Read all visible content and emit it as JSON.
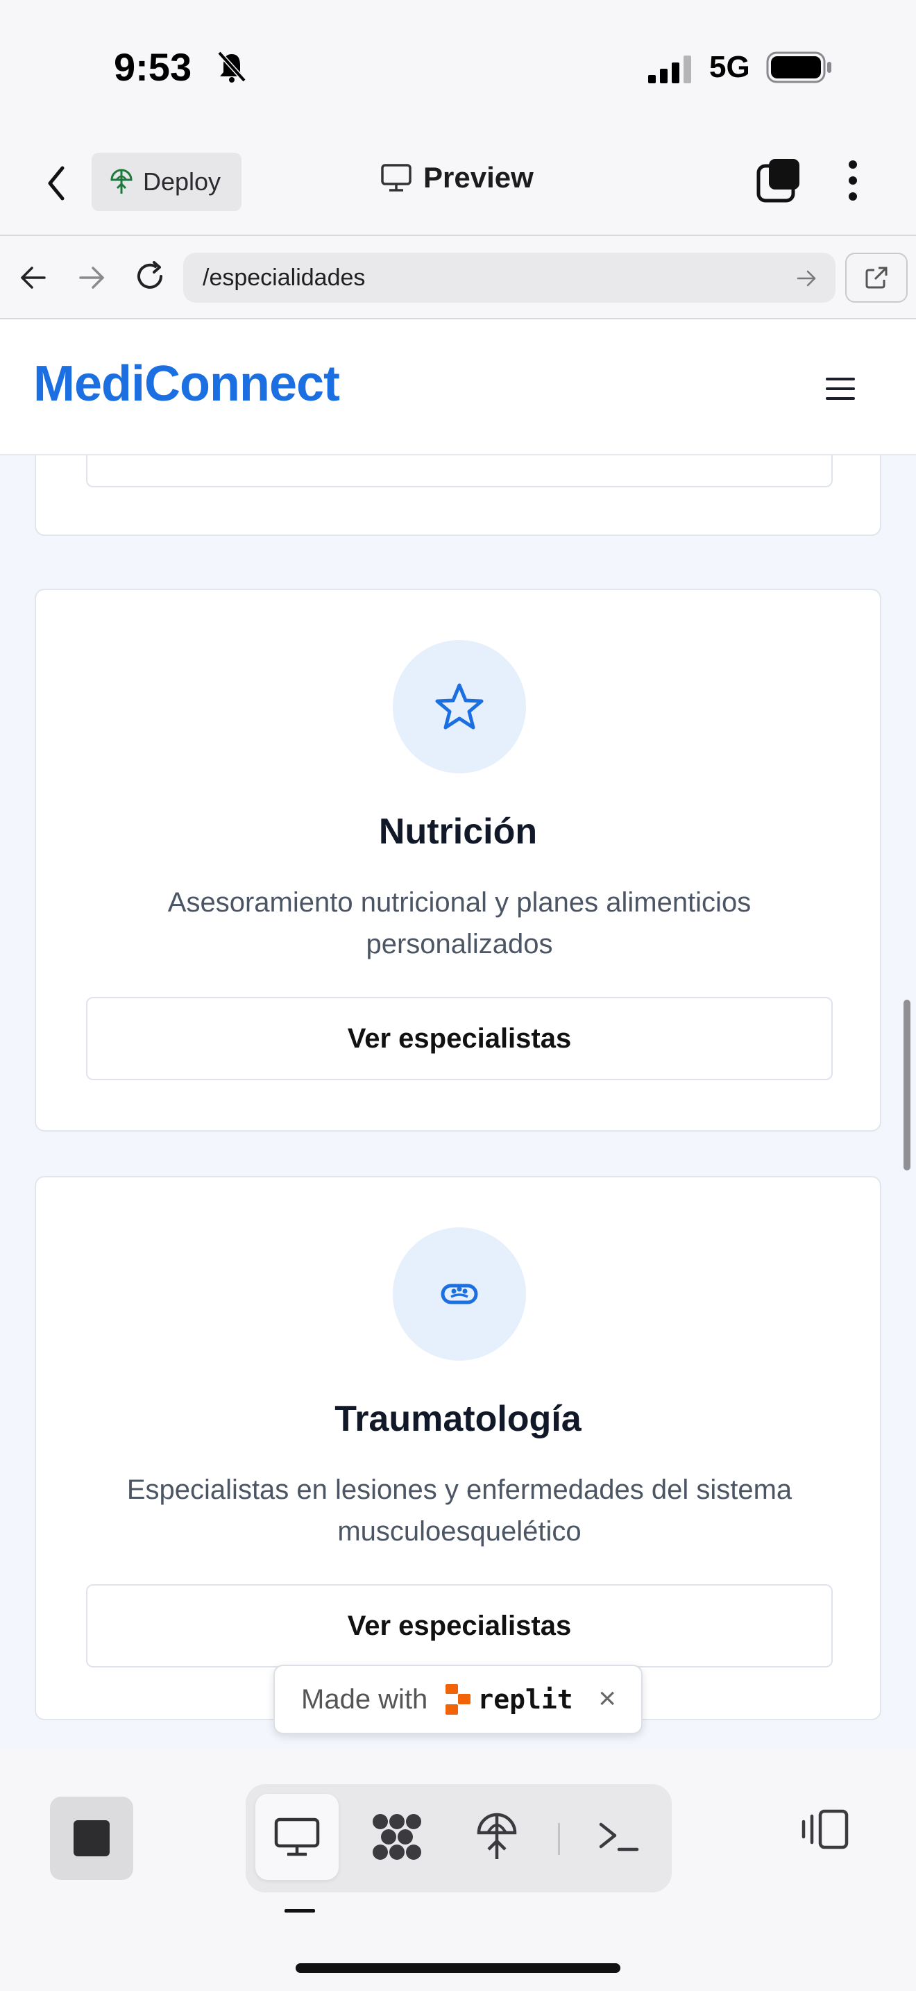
{
  "status_bar": {
    "time": "9:53",
    "network": "5G"
  },
  "toolbar": {
    "deploy_label": "Deploy",
    "preview_label": "Preview"
  },
  "url_bar": {
    "path": "/especialidades"
  },
  "site": {
    "brand": "MediConnect"
  },
  "cards": [
    {
      "icon": "star-icon",
      "title": "Nutrición",
      "description": "Asesoramiento nutricional y planes alimenticios personalizados",
      "button": "Ver especialistas"
    },
    {
      "icon": "bone-icon",
      "title": "Traumatología",
      "description": "Especialistas en lesiones y enfermedades del sistema musculoesquelético",
      "button": "Ver especialistas"
    }
  ],
  "badge": {
    "made_with": "Made with",
    "brand": "replit",
    "close": "×"
  },
  "colors": {
    "brand_blue": "#1b6fe0",
    "icon_bg": "#e6f0fc",
    "replit_orange": "#f26207"
  }
}
